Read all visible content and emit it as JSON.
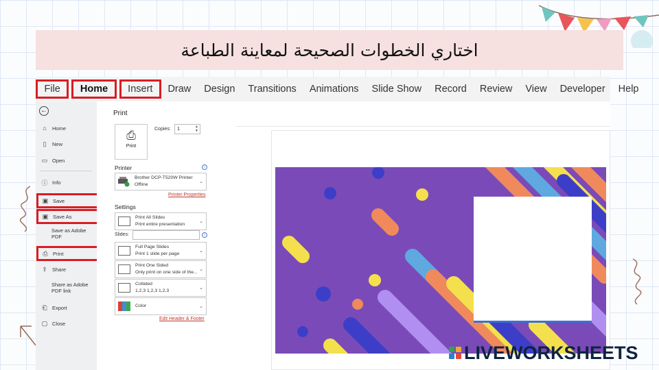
{
  "instruction": "اختاري الخطوات  الصحيحة لمعاينة الطباعة",
  "ribbon": {
    "tabs": [
      "File",
      "Home",
      "Insert",
      "Draw",
      "Design",
      "Transitions",
      "Animations",
      "Slide Show",
      "Record",
      "Review",
      "View",
      "Developer",
      "Help"
    ]
  },
  "nav": {
    "home": "Home",
    "new": "New",
    "open": "Open",
    "info": "Info",
    "save": "Save",
    "save_as": "Save As",
    "save_as_adobe_l1": "Save as Adobe",
    "save_as_adobe_l2": "PDF",
    "print": "Print",
    "share": "Share",
    "share_adobe_l1": "Share as Adobe",
    "share_adobe_l2": "PDF link",
    "export": "Export",
    "close": "Close"
  },
  "print_panel": {
    "title": "Print",
    "print_button": "Print",
    "copies_label": "Copies:",
    "copies_value": "1",
    "printer_heading": "Printer",
    "printer_name": "Brother DCP-T520W Printer",
    "printer_status": "Offline",
    "printer_properties": "Printer Properties",
    "settings_heading": "Settings",
    "setting1_l1": "Print All Slides",
    "setting1_l2": "Print entire presentation",
    "slides_label": "Slides:",
    "setting2_l1": "Full Page Slides",
    "setting2_l2": "Print 1 slide per page",
    "setting3_l1": "Print One Sided",
    "setting3_l2": "Only print on one side of the...",
    "setting4_l1": "Collated",
    "setting4_l2": "1,2,3    1,2,3    1,2,3",
    "setting5_l1": "Color",
    "edit_header_footer": "Edit Header & Footer"
  },
  "logo_text": "LIVEWORKSHEETS",
  "colors": {
    "highlight_box": "#d91c22",
    "banner": "#f6e0e0",
    "slide_bg": "#7a4bb8",
    "link": "#c0392b"
  }
}
